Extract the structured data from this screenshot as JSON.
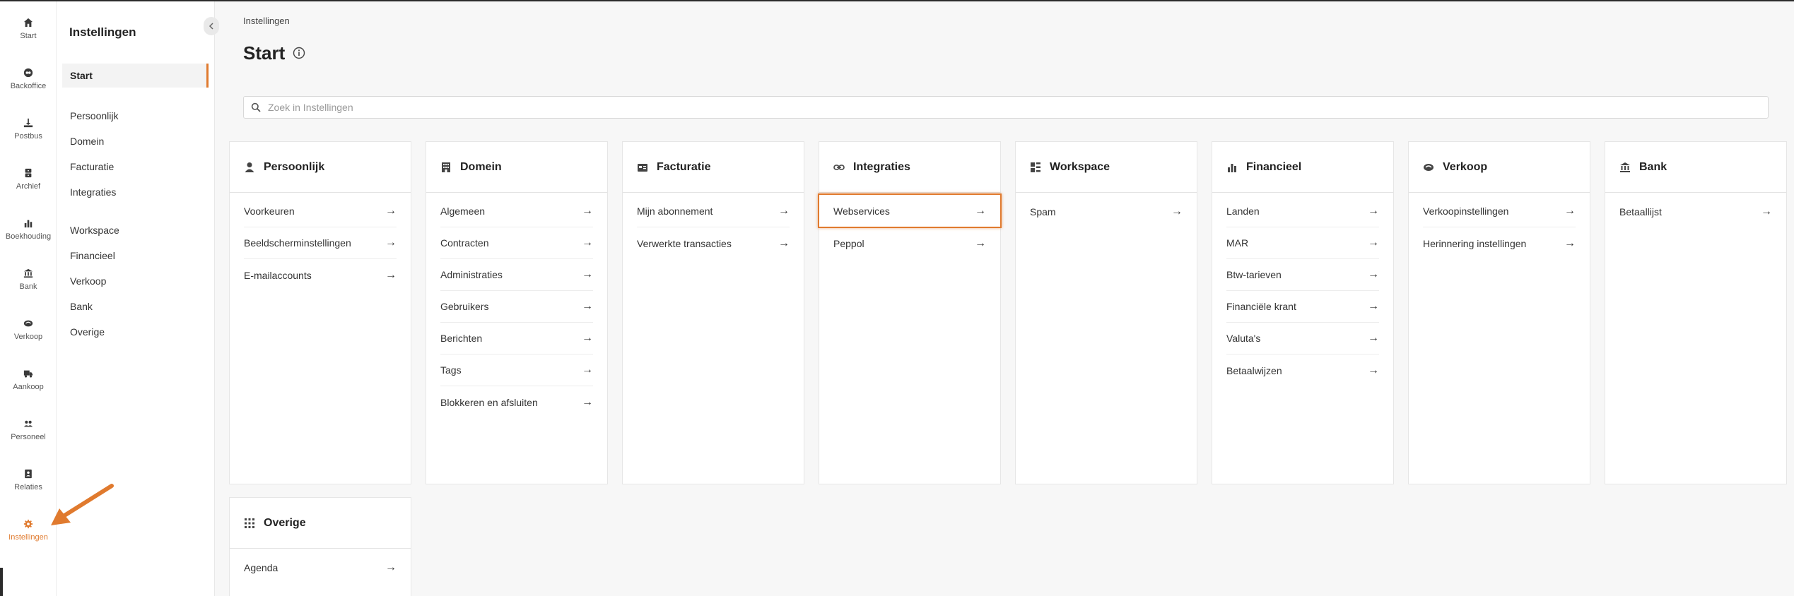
{
  "rail": {
    "items": [
      {
        "label": "Start",
        "icon": "home-icon"
      },
      {
        "label": "Backoffice",
        "icon": "backoffice-icon"
      },
      {
        "label": "Postbus",
        "icon": "inbox-icon"
      },
      {
        "label": "Archief",
        "icon": "archive-icon"
      },
      {
        "label": "Boekhouding",
        "icon": "bar-chart-icon"
      },
      {
        "label": "Bank",
        "icon": "bank-icon"
      },
      {
        "label": "Verkoop",
        "icon": "handshake-icon"
      },
      {
        "label": "Aankoop",
        "icon": "truck-icon"
      },
      {
        "label": "Personeel",
        "icon": "people-icon"
      },
      {
        "label": "Relaties",
        "icon": "contacts-icon"
      },
      {
        "label": "Instellingen",
        "icon": "gear-icon"
      }
    ]
  },
  "subnav": {
    "title": "Instellingen",
    "active": "Start",
    "group1": [
      "Persoonlijk",
      "Domein",
      "Facturatie",
      "Integraties"
    ],
    "group2": [
      "Workspace",
      "Financieel",
      "Verkoop",
      "Bank",
      "Overige"
    ]
  },
  "main": {
    "breadcrumb": "Instellingen",
    "title": "Start",
    "search_placeholder": "Zoek in Instellingen"
  },
  "cards": [
    {
      "title": "Persoonlijk",
      "icon": "person-icon",
      "rows": [
        "Voorkeuren",
        "Beeldscherminstellingen",
        "E-mailaccounts"
      ]
    },
    {
      "title": "Domein",
      "icon": "building-icon",
      "rows": [
        "Algemeen",
        "Contracten",
        "Administraties",
        "Gebruikers",
        "Berichten",
        "Tags",
        "Blokkeren en afsluiten"
      ]
    },
    {
      "title": "Facturatie",
      "icon": "invoice-icon",
      "rows": [
        "Mijn abonnement",
        "Verwerkte transacties"
      ]
    },
    {
      "title": "Integraties",
      "icon": "link-icon",
      "rows": [
        "Webservices",
        "Peppol"
      ]
    },
    {
      "title": "Workspace",
      "icon": "workspace-icon",
      "rows": [
        "Spam"
      ]
    },
    {
      "title": "Financieel",
      "icon": "bar-chart-icon",
      "rows": [
        "Landen",
        "MAR",
        "Btw-tarieven",
        "Financiële krant",
        "Valuta's",
        "Betaalwijzen"
      ]
    },
    {
      "title": "Verkoop",
      "icon": "handshake-icon",
      "rows": [
        "Verkoopinstellingen",
        "Herinnering instellingen"
      ]
    },
    {
      "title": "Bank",
      "icon": "bank-icon",
      "rows": [
        "Betaallijst"
      ]
    },
    {
      "title": "Overige",
      "icon": "grid-icon",
      "rows": [
        "Agenda"
      ]
    }
  ],
  "arrow_glyph": "→",
  "colors": {
    "accent": "#e07a2e"
  }
}
